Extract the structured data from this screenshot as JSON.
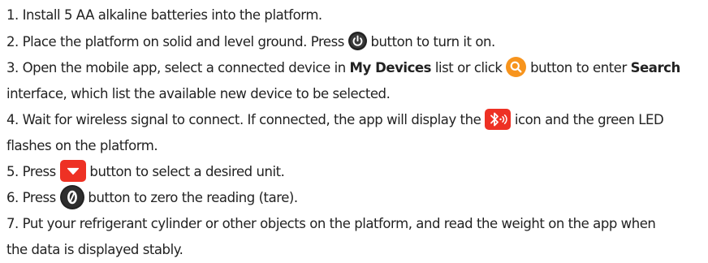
{
  "steps": [
    {
      "text": "1. Install 5 AA alkaline batteries into the platform."
    },
    {
      "part1": "2. Place the platform on solid and level ground. Press",
      "icon": "power-icon",
      "part2": "button to turn it on."
    },
    {
      "part1": "3. Open the mobile app, select a connected device in",
      "bold1": "My Devices",
      "part2": "list or click",
      "icon": "search-icon",
      "part3": "button to enter",
      "bold2": "Search",
      "cont": "interface, which list the available new device to be selected."
    },
    {
      "part1": "4. Wait for wireless signal to connect. If connected, the app will display the",
      "icon": "bluetooth-signal-icon",
      "part2": "icon and the green LED",
      "cont": "flashes on the platform."
    },
    {
      "part1": "5. Press",
      "icon": "down-arrow-icon",
      "part2": "button to select a desired unit."
    },
    {
      "part1": "6. Press",
      "icon": "zero-icon",
      "part2": "button to zero the reading (tare)."
    },
    {
      "part1": "7. Put your refrigerant cylinder or other objects on the platform, and read the weight on the app when",
      "cont": "the data is displayed stably."
    }
  ],
  "colors": {
    "text": "#222222",
    "power_icon": "#222222",
    "search_icon": "#f7941d",
    "bluetooth_icon": "#ee3124",
    "down_arrow_icon": "#ee3124",
    "zero_icon": "#222222"
  }
}
